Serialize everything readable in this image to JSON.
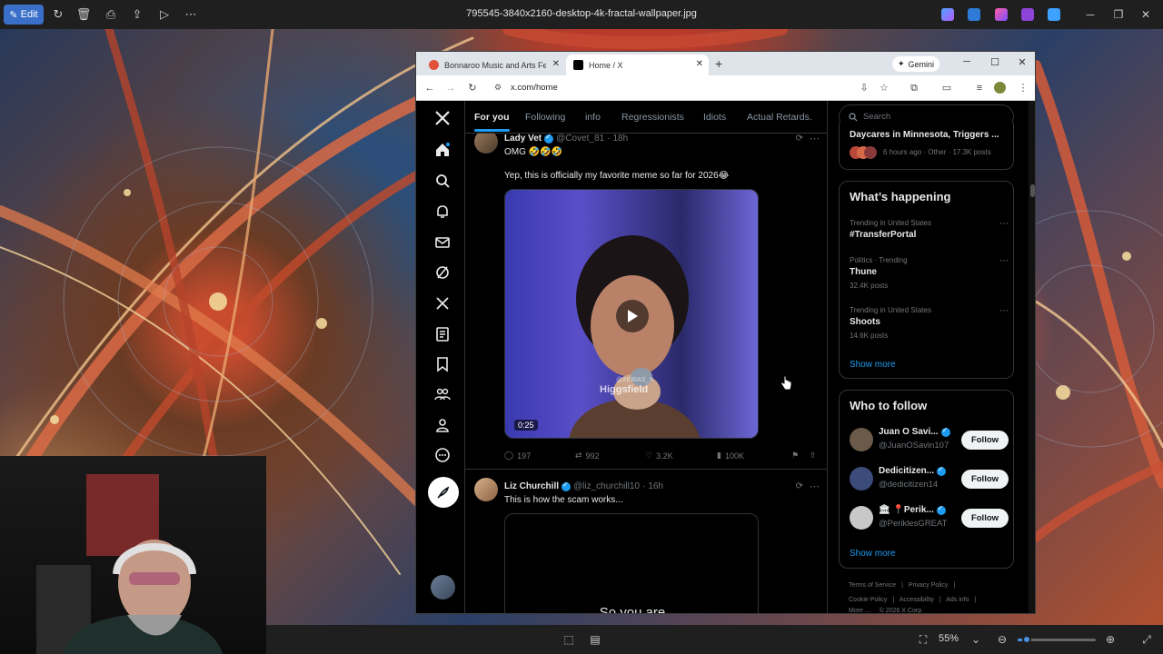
{
  "photos_app": {
    "edit_label": "Edit",
    "filename": "795545-3840x2160-desktop-4k-fractal-wallpaper.jpg",
    "zoom_level": "55%",
    "zoom_fraction": 0.12
  },
  "browser": {
    "tabs": [
      {
        "title": "Bonnaroo Music and Arts Festi",
        "favicon_color": "#e0523a",
        "active": false
      },
      {
        "title": "Home / X",
        "favicon_color": "#000000",
        "active": true
      }
    ],
    "gemini_label": "Gemini",
    "url": "x.com/home"
  },
  "x": {
    "feed_tabs": [
      "For you",
      "Following",
      "info",
      "Regressionists",
      "Idiots",
      "Actual Retards."
    ],
    "tweets": [
      {
        "name": "Lady Vet",
        "handle": "@Covet_81",
        "time": "18h",
        "text_lines": [
          "OMG 🤣🤣🤣",
          "Yep, this is officially my favorite meme so far for 2026😂"
        ],
        "video_duration": "0:25",
        "watermark": "Higgsfield",
        "watermark_small": "@XEBIAS_X",
        "stats": {
          "replies": "197",
          "reposts": "992",
          "likes": "3.2K",
          "views": "100K"
        }
      },
      {
        "name": "Liz Churchill",
        "handle": "@liz_churchill10",
        "time": "16h",
        "text_lines": [
          "This is how the scam works..."
        ],
        "caption": "So you are"
      }
    ],
    "search_placeholder": "Search",
    "top_trend": {
      "title": "Daycares in Minnesota, Triggers ...",
      "meta": "6 hours ago · Other · 17.3K posts"
    },
    "whats_happening": {
      "title": "What’s happening",
      "trends": [
        {
          "context": "Trending in United States",
          "name": "#TransferPortal",
          "count": ""
        },
        {
          "context": "Politics · Trending",
          "name": "Thune",
          "count": "32.4K posts"
        },
        {
          "context": "Trending in United States",
          "name": "Shoots",
          "count": "14.6K posts"
        }
      ],
      "show_more": "Show more"
    },
    "who_to_follow": {
      "title": "Who to follow",
      "accounts": [
        {
          "name": "Juan O Savi...",
          "handle": "@JuanOSavin107",
          "button": "Follow",
          "avatar_color": "#6b5a4a"
        },
        {
          "name": "Dedicitizen...",
          "handle": "@dedicitizen14",
          "button": "Follow",
          "avatar_color": "#3b4b7a"
        },
        {
          "name": "🏛 📍Perik...",
          "handle": "@PeriklesGREAT",
          "button": "Follow",
          "avatar_color": "#c8c8c8"
        }
      ],
      "show_more": "Show more"
    },
    "footer": {
      "line1": [
        "Terms of Service",
        "|",
        "Privacy Policy",
        "|"
      ],
      "line2": [
        "Cookie Policy",
        "|",
        "Accessibility",
        "|",
        "Ads info",
        "|"
      ],
      "line3": [
        "More ...",
        "© 2026 X Corp."
      ]
    }
  }
}
